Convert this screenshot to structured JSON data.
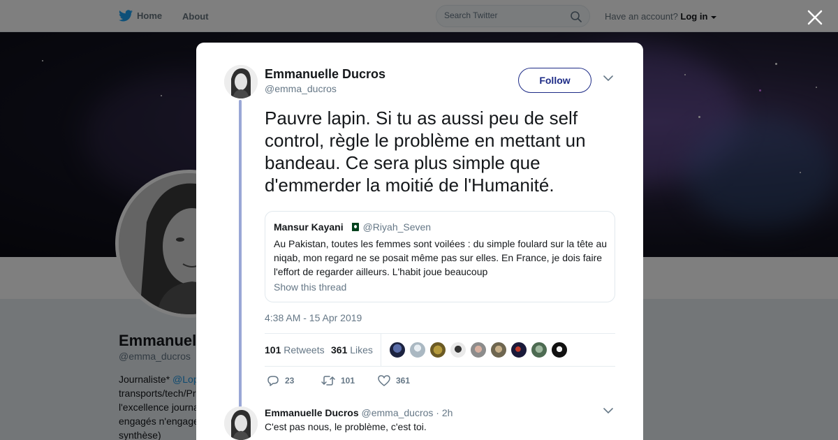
{
  "nav": {
    "home_label": "Home",
    "about_label": "About",
    "search_placeholder": "Search Twitter",
    "account_prompt": "Have an account?",
    "login_label": "Log in"
  },
  "profile": {
    "name": "Emmanuelle Ducros",
    "handle": "@emma_ducros",
    "bio_prefix": "Journaliste*",
    "bio_mention": "@Lop",
    "bio_rest": "transports/tech/Pr l'excellence journa engagés n'engage synthèse)"
  },
  "tweet": {
    "author_name": "Emmanuelle Ducros",
    "author_handle": "@emma_ducros",
    "follow_label": "Follow",
    "text": "Pauvre lapin. Si tu as aussi peu de self control, règle le problème en mettant un bandeau. Ce sera plus simple que d'emmerder la moitié de l'Humanité.",
    "timestamp": "4:38 AM - 15 Apr 2019",
    "retweets_count": "101",
    "retweets_label": "Retweets",
    "likes_count": "361",
    "likes_label": "Likes",
    "reply_count": "23",
    "retweet_action_count": "101",
    "like_action_count": "361"
  },
  "quoted": {
    "name": "Mansur Kayani",
    "handle": "@Riyah_Seven",
    "text": "Au Pakistan, toutes les femmes sont voilées : du simple foulard sur la tête au niqab, mon regard ne se posait même pas sur elles. En France, je dois faire l'effort de regarder ailleurs. L'habit joue beaucoup",
    "show_thread_label": "Show this thread"
  },
  "reply": {
    "name": "Emmanuelle Ducros",
    "meta": "@emma_ducros · 2h",
    "text": "C'est pas nous, le problème, c'est toi."
  },
  "colors": {
    "accent": "#1d2b86",
    "thread_line": "#9aa7d6",
    "muted": "#657786",
    "twitter_blue": "#1da1f2"
  },
  "icons": [
    "twitter-bird-icon",
    "search-icon",
    "caret-down-icon",
    "close-icon",
    "chevron-down-icon",
    "reply-icon",
    "retweet-icon",
    "like-icon",
    "pakistan-flag-icon"
  ]
}
